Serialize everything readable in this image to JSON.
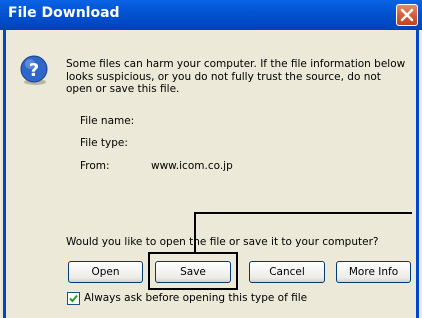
{
  "dialog": {
    "title": "File Download",
    "warning": "Some files can harm your computer. If the file information below looks suspicious, or you do not fully trust the source, do not open or save this file.",
    "file_name_label": "File name:",
    "file_type_label": "File type:",
    "from_label": "From:",
    "from_value": "www.icom.co.jp",
    "prompt": "Would you like to open the file or save it to your computer?",
    "buttons": {
      "open": "Open",
      "save": "Save",
      "cancel": "Cancel",
      "more_info": "More Info"
    },
    "checkbox": {
      "label": "Always ask before opening this type of file",
      "checked": true
    }
  },
  "icons": [
    "question-icon",
    "close-icon",
    "checkmark-icon"
  ],
  "colors": {
    "titlebar": "#0054e3",
    "frame": "#0046c8",
    "dialog_bg": "#ece9d8",
    "close_button": "#d45a3a",
    "question_icon": "#2f66c9"
  }
}
